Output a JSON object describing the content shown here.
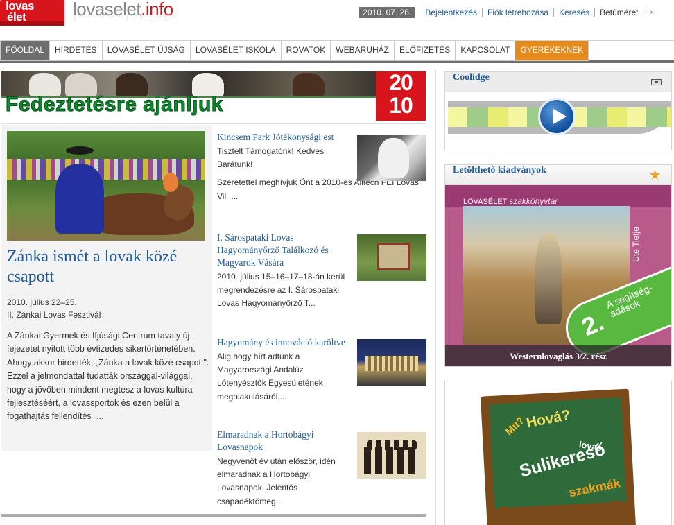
{
  "header": {
    "logo_line1": "lovas",
    "logo_line2": "élet",
    "site_name": "lovaselet",
    "site_tld": ".info",
    "date": "2010. 07. 26.",
    "links": [
      "Bejelentkezés",
      "Fiók létrehozása",
      "Keresés"
    ],
    "font_size_label": "Betűméret",
    "font_size_controls": [
      "+",
      "×",
      "−"
    ]
  },
  "nav": {
    "items": [
      "FŐOLDAL",
      "HIRDETÉS",
      "LOVASÉLET ÚJSÁG",
      "LOVASÉLET ISKOLA",
      "ROVATOK",
      "WEBÁRUHÁZ",
      "ELŐFIZETÉS",
      "KAPCSOLAT",
      "GYEREKEKNEK"
    ],
    "active": "FŐOLDAL",
    "highlight_color": "#e58a1c"
  },
  "banner": {
    "slogan": "Fedeztetésre ajánljuk",
    "year_top": "20",
    "year_bottom": "10"
  },
  "featured": {
    "title": "Zánka ismét a lovak közé csapott",
    "date": "2010. július 22–25.",
    "event": "II. Zánkai Lovas Fesztivál",
    "body": "A Zánkai Gyermek és Ifjúsági Centrum tavaly új fejezetet nyitott több évtizedes sikertörténetében. Ahogy akkor hirdették, „Zánka a lovak közé csapott\". Ezzel a jelmondattal tudatták országgal-világgal, hogy a jövőben mindent megtesz a lovas kultúra fejlesztéséért, a lovassportok és ezen belül a fogathajtás fellendítés..."
  },
  "news": [
    {
      "title": "Kincsem Park Jótékonysági est",
      "text": "Tisztelt Támogatónk! Kedves Barátunk!",
      "text2": "Szeretettel meghívjuk Önt a 2010-es Alltech FEI Lovas Vil..."
    },
    {
      "title": "I. Sárospataki Lovas Hagyományőrző Találkozó és Magyarok Vására",
      "text": "2010. július 15–16–17–18-án kerül megrendezésre az I. Sárospataki Lovas Hagyományőrző T..."
    },
    {
      "title": "Hagyomány és innováció karöltve",
      "text": "Alig hogy hírt adtunk a Magyarországi Andalúz Lótenyésztők Egyesületének megalakulásáról,..."
    },
    {
      "title": "Elmaradnak a Hortobágyi Lovasnapok",
      "text": "Negyvenöt év után először, idén elmaradnak a Hortobágyi Lovasnapok. Jelentős csapadéktömeg..."
    }
  ],
  "sidebar": {
    "video_box": {
      "title": "Coolidge"
    },
    "downloads_box": {
      "title": "Letölthető kiadványok",
      "book_series_prefix": "LOVASÉLET",
      "book_series": "szakkönyvtár",
      "book_author": "Ute Tietje",
      "sticker_number": "2.",
      "sticker_text": "A segítség-adások",
      "caption": "Westernlovaglás 3/2. rész"
    },
    "school_box": {
      "words": [
        "Mit?",
        "Hová?",
        "Sulikereső",
        "lovas",
        "szakmák"
      ]
    }
  },
  "colors": {
    "link_blue": "#1f5d99",
    "brand_red": "#d8151c",
    "nav_active_gray": "#6d6d6d",
    "kids_orange": "#e58a1c"
  }
}
